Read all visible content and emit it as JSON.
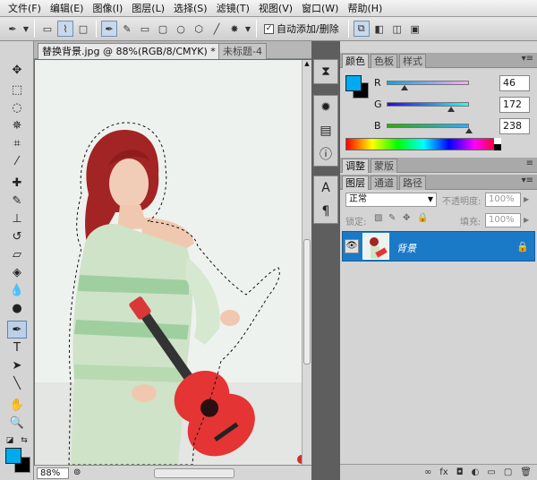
{
  "menu": [
    "文件(F)",
    "编辑(E)",
    "图像(I)",
    "图层(L)",
    "选择(S)",
    "滤镜(T)",
    "视图(V)",
    "窗口(W)",
    "帮助(H)"
  ],
  "options_bar": {
    "auto_add_delete_label": "自动添加/删除",
    "auto_add_delete_checked": "✓"
  },
  "document": {
    "active_tab": "替换背景.jpg @ 88%(RGB/8/CMYK) *",
    "inactive_tab": "未标题-4",
    "zoom": "88%"
  },
  "color_panel": {
    "tabs": [
      "颜色",
      "色板",
      "样式"
    ],
    "r_label": "R",
    "r_value": "46",
    "g_label": "G",
    "g_value": "172",
    "b_label": "B",
    "b_value": "238",
    "foreground_color": "#00aaee",
    "background_color": "#000000"
  },
  "adjust_panel": {
    "tabs": [
      "调整",
      "蒙版"
    ]
  },
  "layers_panel": {
    "tabs": [
      "图层",
      "通道",
      "路径"
    ],
    "blend_mode": "正常",
    "opacity_label": "不透明度:",
    "opacity_value": "100%",
    "lock_label": "锁定:",
    "fill_label": "填充:",
    "fill_value": "100%",
    "layer_name": "背景",
    "bottom_icons": [
      "∞",
      "fx",
      "◘",
      "◐",
      "▭",
      "▢",
      "🗑"
    ]
  }
}
